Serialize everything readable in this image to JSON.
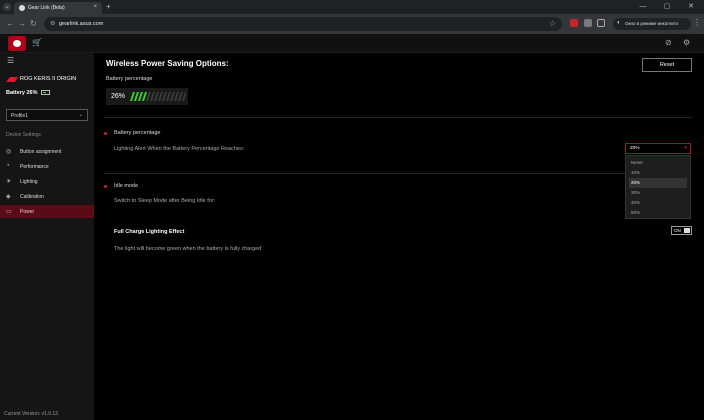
{
  "browser": {
    "tab_title": "Gear Link (Beta)",
    "tab_close": "×",
    "new_tab": "+",
    "url": "gearlink.asus.com",
    "incognito_label": "Окно в режиме инкогнито",
    "tab_search_icon": "chevron-down-icon",
    "window_controls": [
      "—",
      "▢",
      "✕"
    ]
  },
  "app_header": {
    "icons": [
      "armoury-icon",
      "store-icon",
      "check-icon",
      "settings-icon"
    ]
  },
  "sidebar": {
    "device_name": "ROG KERIS II ORIGIN",
    "battery_label": "Battery 26%",
    "profile": "Profile1",
    "section_label": "Device Settings",
    "items": [
      {
        "label": "Button assignment",
        "icon": "button-icon",
        "glyph": "◎",
        "active": false
      },
      {
        "label": "Performance",
        "icon": "performance-icon",
        "glyph": "◔",
        "active": false
      },
      {
        "label": "Lighting",
        "icon": "lighting-icon",
        "glyph": "☀",
        "active": false
      },
      {
        "label": "Calibration",
        "icon": "calibration-icon",
        "glyph": "◈",
        "active": false
      },
      {
        "label": "Power",
        "icon": "battery-icon",
        "glyph": "▭",
        "active": true
      }
    ],
    "version": "Current Version: v1.0.13"
  },
  "main": {
    "title": "Wireless Power Saving Options:",
    "reset_label": "Reset",
    "battery_percentage_label": "Battery percentage",
    "battery_value": "26%",
    "battery_level": 0.26,
    "battery_alert": {
      "heading": "Battery percentage",
      "description": "Lighting Alert When the Battery Percentage Reaches:",
      "selected_value": "20%",
      "options": [
        "Never",
        "10%",
        "20%",
        "30%",
        "40%",
        "50%"
      ],
      "selected_index": 2
    },
    "idle_mode": {
      "heading": "Idle mode",
      "description": "Switch to Sleep Mode after Being Idle for:"
    },
    "full_charge": {
      "heading": "Full Charge Lighting Effect",
      "description": "The light will become green when the battery is fully charged",
      "toggle_label": "ON",
      "enabled": true
    }
  },
  "colors": {
    "accent": "#e0162b",
    "active_nav": "#5a0b16",
    "battery_green": "#3bd12c"
  }
}
